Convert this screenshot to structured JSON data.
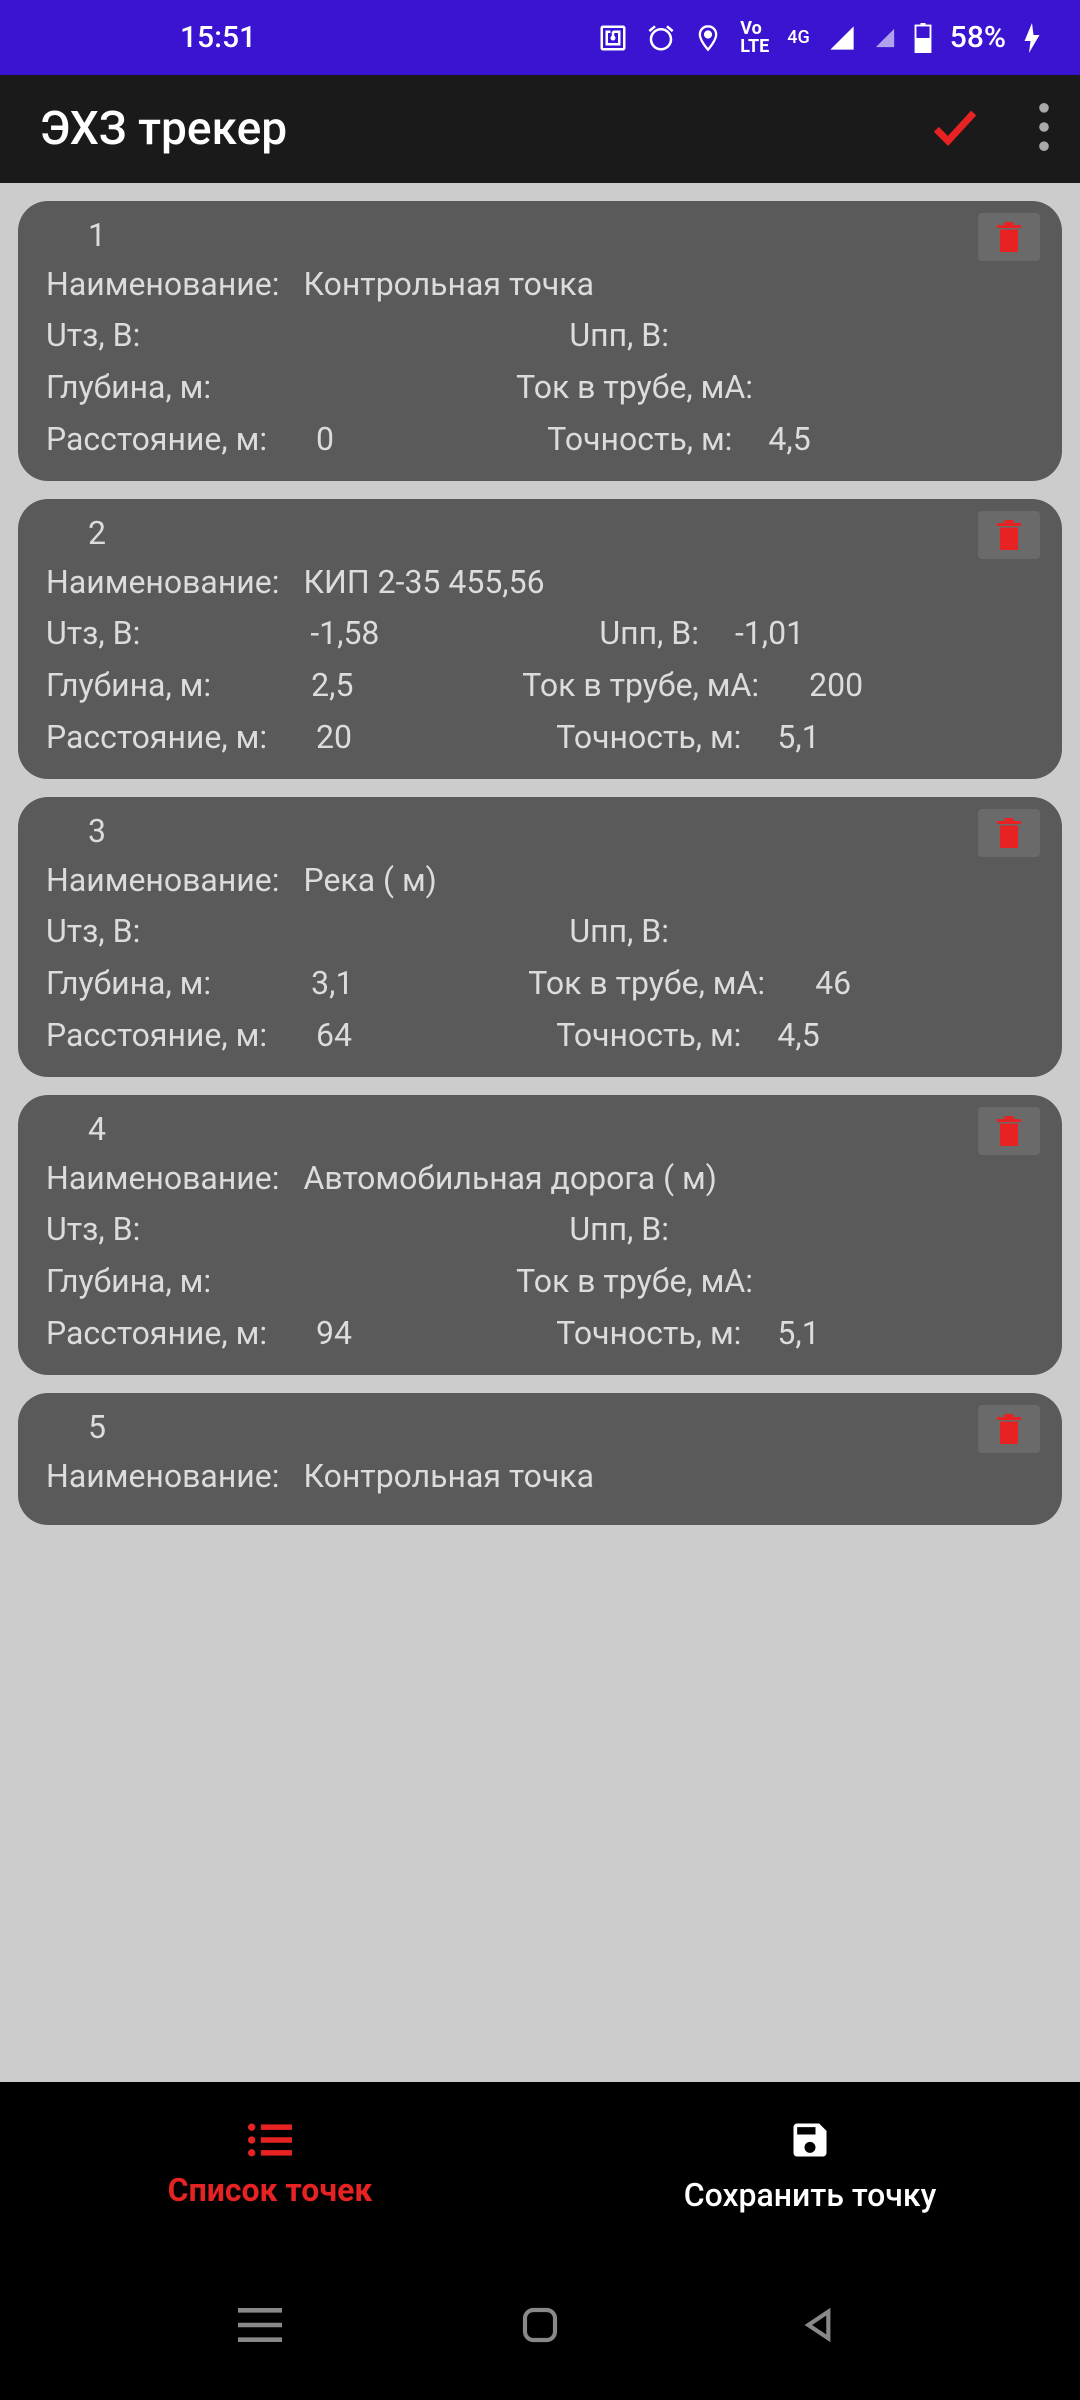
{
  "status": {
    "time": "15:51",
    "battery": "58%"
  },
  "app": {
    "title": "ЭХЗ трекер"
  },
  "labels": {
    "name": "Наименование:",
    "utz": "Uтз, В:",
    "upp": "Uпп, В:",
    "depth": "Глубина, м:",
    "current": "Ток в трубе, мА:",
    "distance": "Расстояние, м:",
    "accuracy": "Точность, м:"
  },
  "points": [
    {
      "idx": "1",
      "name": "Контрольная точка",
      "utz": "",
      "upp": "",
      "depth": "",
      "current": "",
      "distance": "0",
      "accuracy": "4,5"
    },
    {
      "idx": "2",
      "name": "КИП   2-35   455,56",
      "utz": "-1,58",
      "upp": "-1,01",
      "depth": "2,5",
      "current": "200",
      "distance": "20",
      "accuracy": "5,1"
    },
    {
      "idx": "3",
      "name": "Река ( м)",
      "utz": "",
      "upp": "",
      "depth": "3,1",
      "current": "46",
      "distance": "64",
      "accuracy": "4,5"
    },
    {
      "idx": "4",
      "name": "Автомобильная дорога ( м)",
      "utz": "",
      "upp": "",
      "depth": "",
      "current": "",
      "distance": "94",
      "accuracy": "5,1"
    },
    {
      "idx": "5",
      "name": "Контрольная точка",
      "utz": "",
      "upp": "",
      "depth": "",
      "current": "",
      "distance": "",
      "accuracy": ""
    }
  ],
  "tabs": {
    "list": "Список точек",
    "save": "Сохранить точку"
  }
}
